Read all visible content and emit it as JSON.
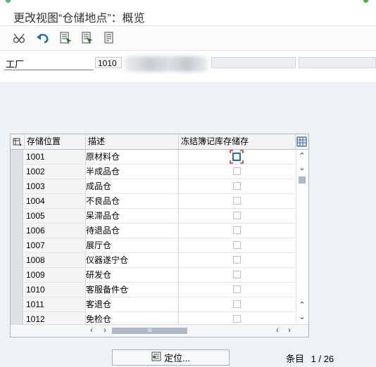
{
  "window": {
    "title": "更改视图“仓储地点”：概览"
  },
  "toolbar": {
    "buttons": [
      {
        "name": "glasses-icon"
      },
      {
        "name": "undo-icon"
      },
      {
        "name": "list-select-icon"
      },
      {
        "name": "document-select-icon"
      },
      {
        "name": "document-icon"
      }
    ]
  },
  "plant": {
    "label": "工厂",
    "value": "1010"
  },
  "table": {
    "columns": [
      "存储位置",
      "描述",
      "冻结簿记库存储存"
    ],
    "rows": [
      {
        "code": "1001",
        "desc": "原材料仓",
        "frozen": false
      },
      {
        "code": "1002",
        "desc": "半成品仓",
        "frozen": false
      },
      {
        "code": "1003",
        "desc": "成品仓",
        "frozen": false
      },
      {
        "code": "1004",
        "desc": "不良品仓",
        "frozen": false
      },
      {
        "code": "1005",
        "desc": "呆滞品仓",
        "frozen": false
      },
      {
        "code": "1006",
        "desc": "待退品仓",
        "frozen": false
      },
      {
        "code": "1007",
        "desc": "展厅仓",
        "frozen": false
      },
      {
        "code": "1008",
        "desc": "仪器遂宁仓",
        "frozen": false
      },
      {
        "code": "1009",
        "desc": "研发仓",
        "frozen": false
      },
      {
        "code": "1010",
        "desc": "客服备件仓",
        "frozen": false
      },
      {
        "code": "1011",
        "desc": "客退仓",
        "frozen": false
      },
      {
        "code": "1012",
        "desc": "免检仓",
        "frozen": false
      }
    ],
    "hscroll_thumb": "III"
  },
  "footer": {
    "locate_label": "定位...",
    "entries_label": "条目",
    "entries_value": "1 / 26"
  }
}
